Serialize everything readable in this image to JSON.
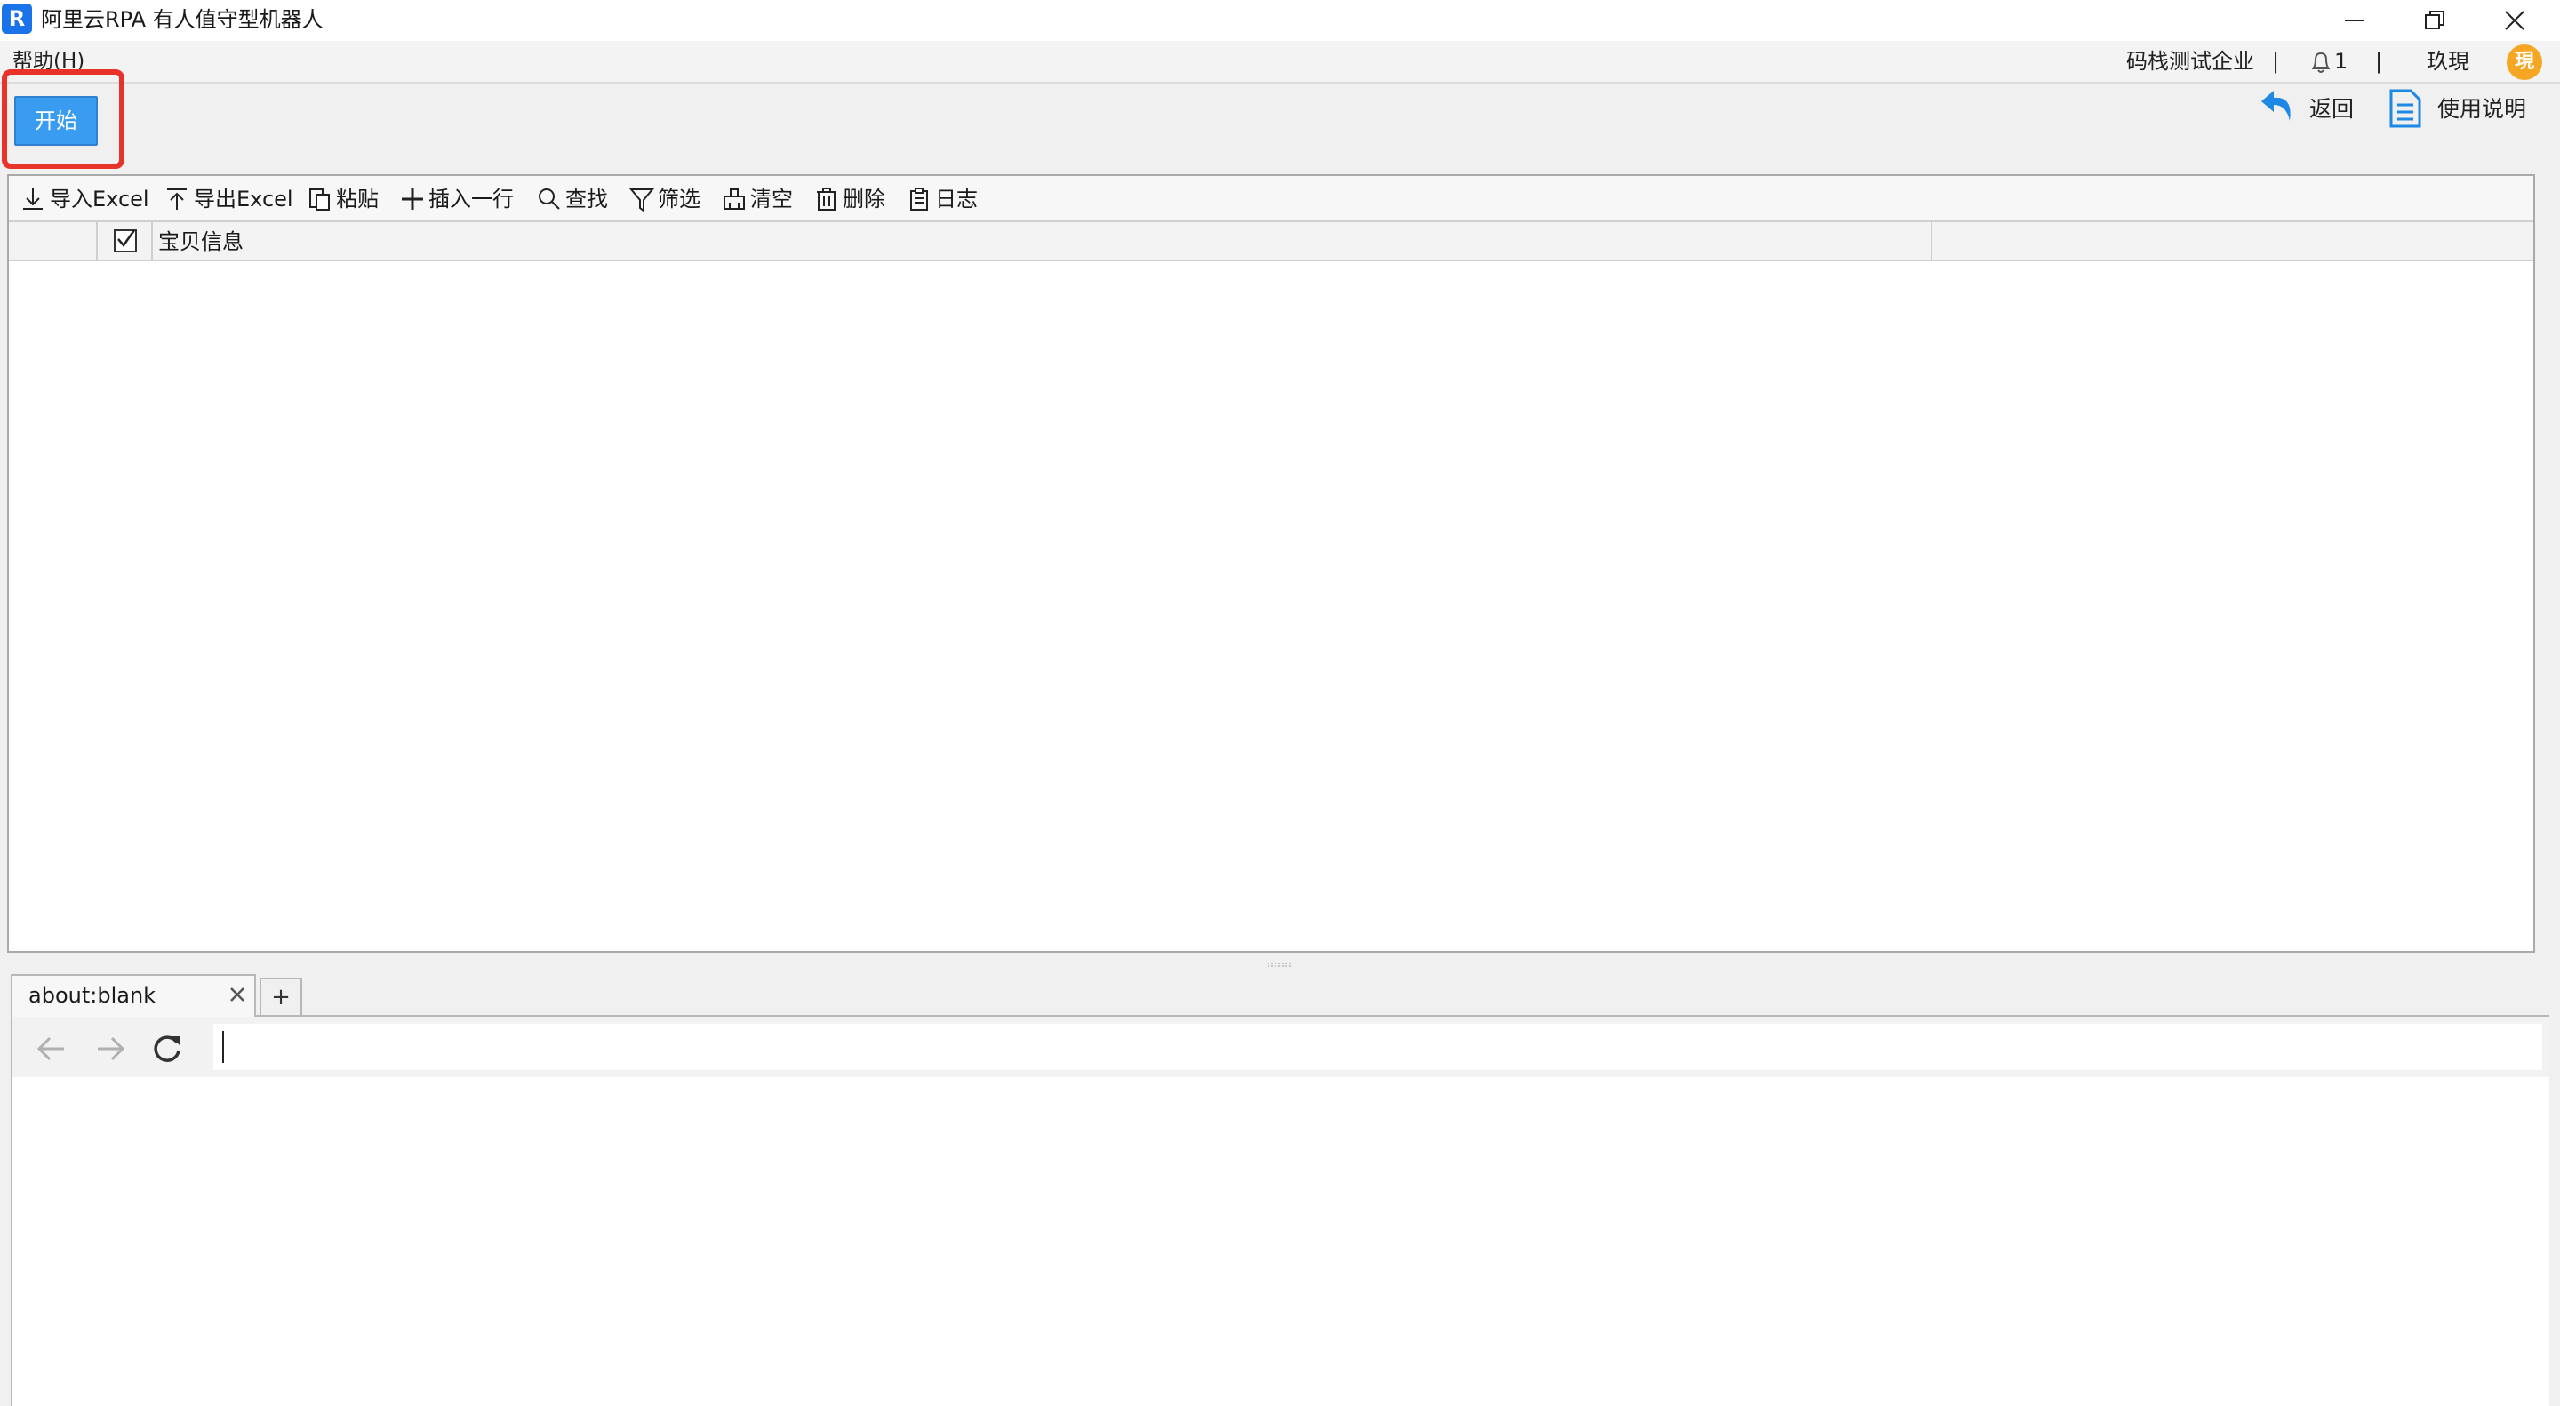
{
  "window": {
    "title": "阿里云RPA 有人值守型机器人",
    "logo_letter": "R"
  },
  "menu": {
    "help_label": "帮助(H)"
  },
  "top_right": {
    "company": "码栈测试企业",
    "separator": "|",
    "notification_count": "1",
    "username": "玖現",
    "avatar_text": "現"
  },
  "actions": {
    "start_label": "开始",
    "return_label": "返回",
    "manual_label": "使用说明"
  },
  "grid": {
    "toolbar": [
      {
        "name": "import-excel",
        "label": "导入Excel",
        "icon": "download-icon"
      },
      {
        "name": "export-excel",
        "label": "导出Excel",
        "icon": "upload-icon"
      },
      {
        "name": "paste",
        "label": "粘贴",
        "icon": "paste-icon"
      },
      {
        "name": "insert-row",
        "label": "插入一行",
        "icon": "plus-icon"
      },
      {
        "name": "find",
        "label": "查找",
        "icon": "search-icon"
      },
      {
        "name": "filter",
        "label": "筛选",
        "icon": "filter-icon"
      },
      {
        "name": "clear",
        "label": "清空",
        "icon": "eraser-icon"
      },
      {
        "name": "delete",
        "label": "删除",
        "icon": "trash-icon"
      },
      {
        "name": "log",
        "label": "日志",
        "icon": "clipboard-icon"
      }
    ],
    "columns": [
      "宝贝信息",
      ""
    ],
    "rows": []
  },
  "browser": {
    "tab_label": "about:blank",
    "new_tab_label": "+",
    "address_value": ""
  },
  "colors": {
    "start_button": "#3a9cf0",
    "highlight": "#e8332a",
    "avatar": "#f5a623",
    "link_icon": "#1e88e5"
  }
}
